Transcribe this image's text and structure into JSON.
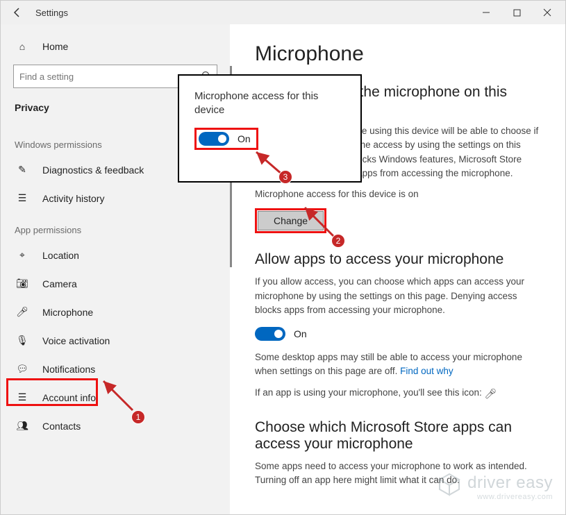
{
  "titlebar": {
    "title": "Settings"
  },
  "sidebar": {
    "home": "Home",
    "search_placeholder": "Find a setting",
    "privacy": "Privacy",
    "group_win_perm": "Windows permissions",
    "group_app_perm": "App permissions",
    "items_win": [
      {
        "icon": "diagnostics-icon",
        "label": "Diagnostics & feedback"
      },
      {
        "icon": "activity-icon",
        "label": "Activity history"
      }
    ],
    "items_app": [
      {
        "icon": "location-icon",
        "label": "Location"
      },
      {
        "icon": "camera-icon",
        "label": "Camera"
      },
      {
        "icon": "microphone-icon",
        "label": "Microphone"
      },
      {
        "icon": "voice-icon",
        "label": "Voice activation"
      },
      {
        "icon": "notifications-icon",
        "label": "Notifications"
      },
      {
        "icon": "account-icon",
        "label": "Account info"
      },
      {
        "icon": "contacts-icon",
        "label": "Contacts"
      }
    ]
  },
  "page": {
    "h1": "Microphone",
    "section1_title": "Allow access to the microphone on this device",
    "section1_body": "If you allow access, people using this device will be able to choose if their apps have microphone access by using the settings on this page. Denying access blocks Windows features, Microsoft Store apps, and most desktop apps from accessing the microphone.",
    "status_line": "Microphone access for this device is on",
    "change_btn": "Change",
    "section2_title": "Allow apps to access your microphone",
    "section2_body": "If you allow access, you can choose which apps can access your microphone by using the settings on this page. Denying access blocks apps from accessing your microphone.",
    "toggle_on": "On",
    "desktop_note_a": "Some desktop apps may still be able to access your microphone when settings on this page are off. ",
    "desktop_note_link": "Find out why",
    "using_line": "If an app is using your microphone, you'll see this icon:",
    "section3_title": "Choose which Microsoft Store apps can access your microphone",
    "section3_body": "Some apps need to access your microphone to work as intended. Turning off an app here might limit what it can do."
  },
  "popup": {
    "title": "Microphone access for this device",
    "toggle_label": "On"
  },
  "annotations": {
    "step1": "1",
    "step2": "2",
    "step3": "3"
  },
  "watermark": {
    "brand": "driver easy",
    "url": "www.drivereasy.com"
  },
  "colors": {
    "accent": "#0067c0",
    "highlight": "#e11",
    "badge": "#c62828"
  }
}
